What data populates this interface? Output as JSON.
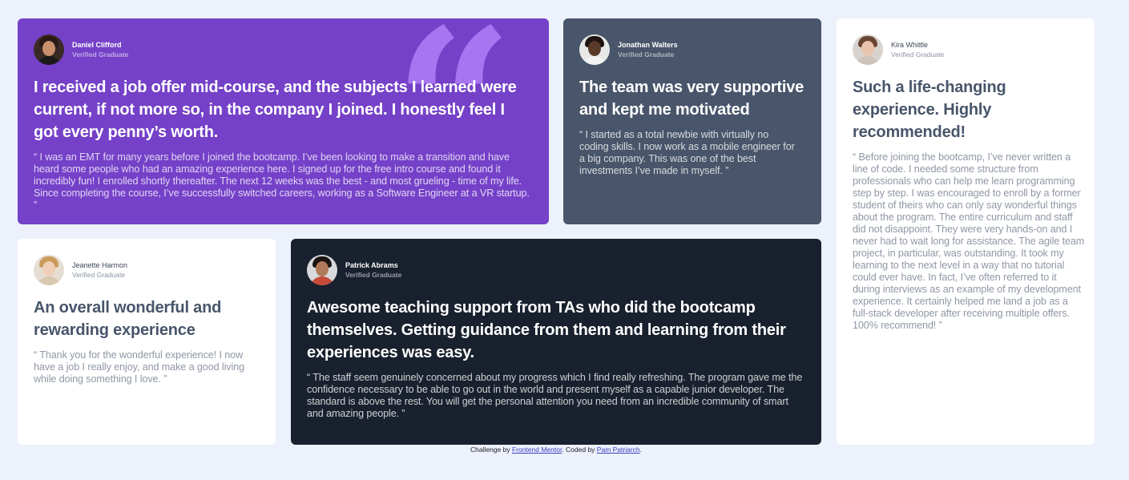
{
  "testimonials": {
    "daniel": {
      "name": "Daniel Clifford",
      "role": "Verified Graduate",
      "headline": "I received a job offer mid-course, and the subjects I learned were current, if not more so, in the company I joined. I honestly feel I got every penny’s worth.",
      "quote": "“ I was an EMT for many years before I joined the bootcamp. I’ve been looking to make a transition and have heard some people who had an amazing experience here. I signed up for the free intro course and found it incredibly fun! I enrolled shortly thereafter. The next 12 weeks was the best - and most grueling - time of my life. Since completing the course, I’ve successfully switched careers, working as a Software Engineer at a VR startup. ”",
      "quote_glyph": "“"
    },
    "jonathan": {
      "name": "Jonathan Walters",
      "role": "Verified Graduate",
      "headline": "The team was very supportive and kept me motivated",
      "quote": "“ I started as a total newbie with virtually no coding skills. I now work as a mobile engineer for a big company. This was one of the best investments I’ve made in myself. ”"
    },
    "kira": {
      "name": "Kira Whittle",
      "role": "Verified Graduate",
      "headline": "Such a life-changing experience. Highly recommended!",
      "quote": "“ Before joining the bootcamp, I’ve never written a line of code. I needed some structure from professionals who can help me learn programming step by step. I was encouraged to enroll by a former student of theirs who can only say wonderful things about the program. The entire curriculum and staff did not disappoint. They were very hands-on and I never had to wait long for assistance. The agile team project, in particular, was outstanding. It took my learning to the next level in a way that no tutorial could ever have. In fact, I’ve often referred to it during interviews as an example of my development experience. It certainly helped me land a job as a full-stack developer after receiving multiple offers. 100% recommend! ”"
    },
    "jeanette": {
      "name": "Jeanette Harmon",
      "role": "Verified Graduate",
      "headline": "An overall wonderful and rewarding experience",
      "quote": "“ Thank you for the wonderful experience! I now have a job I really enjoy, and make a good living while doing something I love. ”"
    },
    "patrick": {
      "name": "Patrick Abrams",
      "role": "Verified Graduate",
      "headline": "Awesome teaching support from TAs who did the bootcamp themselves. Getting guidance from them and learning from their experiences was easy.",
      "quote": "“ The staff seem genuinely concerned about my progress which I find really refreshing. The program gave me the confidence necessary to be able to go out in the world and present myself as a capable junior developer. The standard is above the rest. You will get the personal attention you need from an incredible community of smart and amazing people. ”"
    }
  },
  "footer": {
    "prefix": "Challenge by ",
    "challenge_link": "Frontend Mentor",
    "middle": ". Coded by ",
    "author_link": "Pam Patriarch",
    "suffix": "."
  },
  "colors": {
    "purple": "#7541c8",
    "grey_blue": "#48556a",
    "dark": "#19212e",
    "background": "#ecf1fb"
  }
}
